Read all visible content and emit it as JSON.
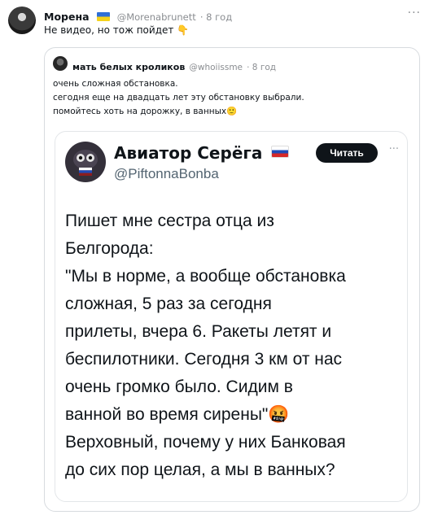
{
  "tweet": {
    "author_name": "Морена",
    "author_handle": "@Morenabrunett",
    "time": "· 8 год",
    "text": "Не видео, но тож пойдет",
    "emoji": "👇",
    "more_icon": "more-dots-icon"
  },
  "quoted": {
    "author_name": "мать белых кроликов",
    "author_handle": "@whoiissme",
    "time": "· 8 год",
    "lines": [
      "очень сложная обстановка.",
      "сегодня еще на двадцать лет эту обстановку выбрали.",
      "помойтесь хоть на дорожку, в ванных"
    ],
    "emoji": "🙂"
  },
  "screenshot": {
    "author_name": "Авиатор Серёга",
    "author_handle": "@PiftonnaBonba",
    "follow_label": "Читать",
    "more": "···",
    "lines": [
      "Пишет мне сестра отца из",
      "Белгорода:",
      "\"Мы в норме, а вообще обстановка",
      "сложная, 5 раз за сегодня",
      "прилеты, вчера 6. Ракеты летят и",
      "беспилотники. Сегодня 3 км от нас",
      "очень громко было. Сидим в",
      "ванной во время сирены\"",
      "Верховный, почему у них Банковая",
      "до сих пор целая, а мы в ванных?"
    ],
    "emoji": "🤬"
  }
}
